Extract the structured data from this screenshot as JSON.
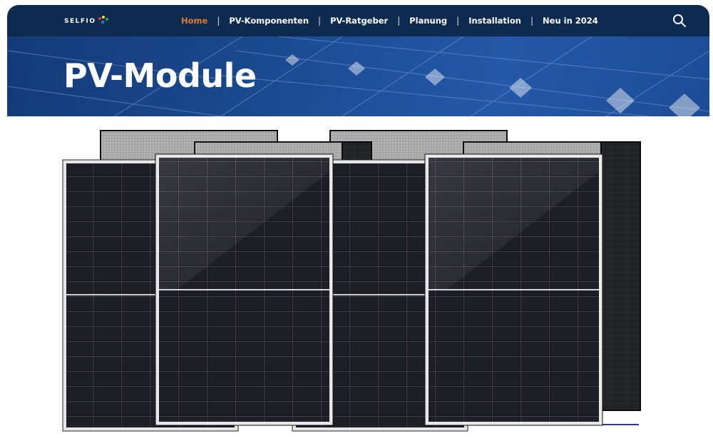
{
  "brand": {
    "name": "SELFIO",
    "colors": [
      "#e53935",
      "#fdd835",
      "#43a047",
      "#1e88e5"
    ]
  },
  "nav": {
    "items": [
      {
        "label": "Home",
        "active": true
      },
      {
        "label": "PV-Komponenten",
        "active": false
      },
      {
        "label": "PV-Ratgeber",
        "active": false
      },
      {
        "label": "Planung",
        "active": false
      },
      {
        "label": "Installation",
        "active": false
      },
      {
        "label": "Neu in 2024",
        "active": false
      }
    ],
    "search_icon": "search-icon"
  },
  "hero": {
    "title": "PV-Module"
  },
  "product_image": {
    "icon": "solar-panel-icon"
  },
  "colors": {
    "nav_bg": "#0e2a4f",
    "active": "#e07a34",
    "hero_bg": "#1b4b92"
  }
}
